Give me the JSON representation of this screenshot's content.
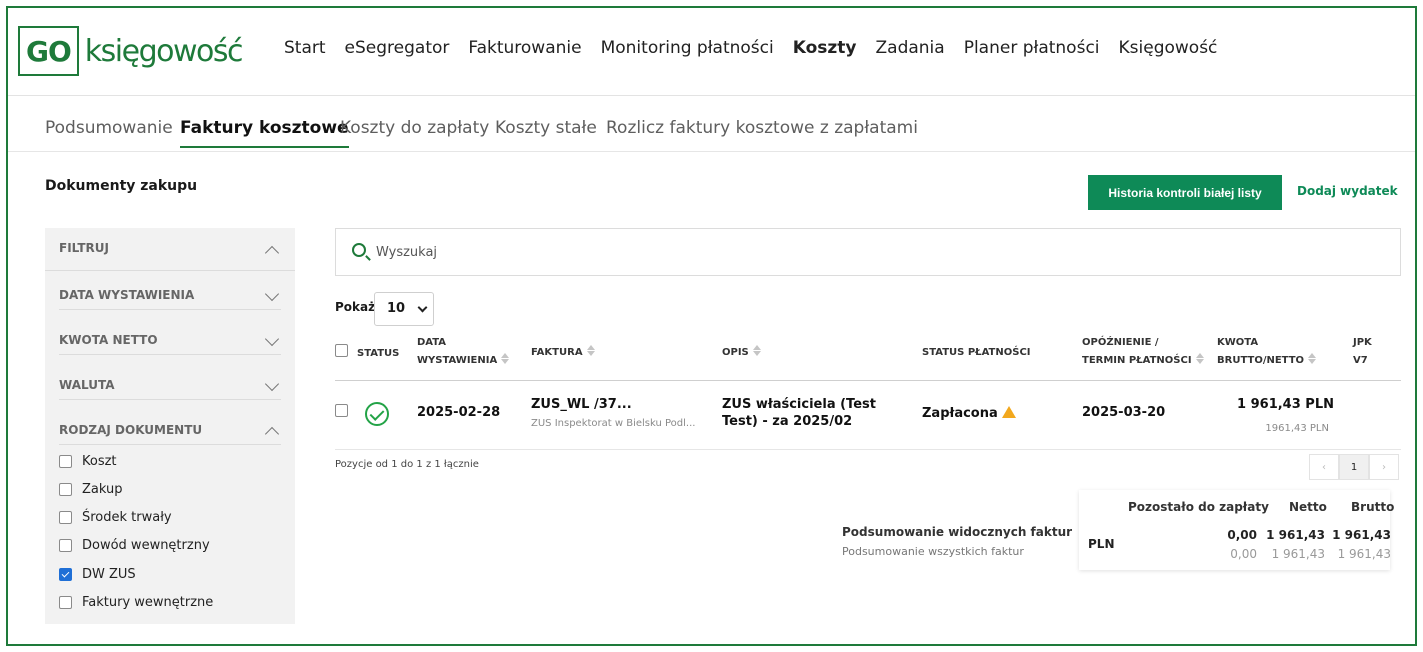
{
  "logo": {
    "badge": "GO",
    "text": "księgowość"
  },
  "main_nav": [
    {
      "label": "Start",
      "active": false
    },
    {
      "label": "eSegregator",
      "active": false
    },
    {
      "label": "Fakturowanie",
      "active": false
    },
    {
      "label": "Monitoring płatności",
      "active": false
    },
    {
      "label": "Koszty",
      "active": true
    },
    {
      "label": "Zadania",
      "active": false
    },
    {
      "label": "Planer płatności",
      "active": false
    },
    {
      "label": "Księgowość",
      "active": false
    }
  ],
  "sub_nav": {
    "summary": "Podsumowanie",
    "cost_invoices": "Faktury kosztowe",
    "costs_to_pay": "Koszty do zapłaty",
    "fixed_costs": "Koszty stałe",
    "settle": "Rozlicz faktury kosztowe z zapłatami"
  },
  "section_title": "Dokumenty zakupu",
  "buttons": {
    "history": "Historia kontroli białej listy",
    "add_expense": "Dodaj wydatek"
  },
  "filters": {
    "header": "FILTRUJ",
    "issue_date": "DATA WYSTAWIENIA",
    "net_amount": "KWOTA NETTO",
    "currency": "WALUTA",
    "doc_type": "RODZAJ DOKUMENTU",
    "doc_types": [
      {
        "label": "Koszt",
        "checked": false
      },
      {
        "label": "Zakup",
        "checked": false
      },
      {
        "label": "Środek trwały",
        "checked": false
      },
      {
        "label": "Dowód wewnętrzny",
        "checked": false
      },
      {
        "label": "DW ZUS",
        "checked": true
      },
      {
        "label": "Faktury wewnętrzne",
        "checked": false
      }
    ]
  },
  "search": {
    "placeholder": "Wyszukaj"
  },
  "show": {
    "label": "Pokaż",
    "value": "10"
  },
  "table": {
    "headers": {
      "status": "STATUS",
      "issue_date_1": "DATA",
      "issue_date_2": "WYSTAWIENIA",
      "invoice": "FAKTURA",
      "description": "OPIS",
      "payment_status": "STATUS PŁATNOŚCI",
      "delay_1": "OPÓŹNIENIE /",
      "delay_2": "TERMIN PŁATNOŚCI",
      "amount_1": "KWOTA",
      "amount_2": "BRUTTO/NETTO",
      "jpk_1": "JPK",
      "jpk_2": "V7"
    },
    "rows": [
      {
        "issue_date": "2025-02-28",
        "invoice": "ZUS_WL /37...",
        "issuer": "ZUS Inspektorat w Bielsku Podl...",
        "description_1": "ZUS właściciela (Test",
        "description_2": "Test) - za 2025/02",
        "payment_status": "Zapłacona",
        "due_date": "2025-03-20",
        "gross": "1 961,43  PLN",
        "net": "1961,43 PLN"
      }
    ]
  },
  "pagination": {
    "info": "Pozycje od 1 do 1 z 1 łącznie",
    "prev": "‹",
    "page": "1",
    "next": "›"
  },
  "summary": {
    "visible_label": "Podsumowanie widocznych faktur",
    "all_label": "Podsumowanie wszystkich faktur",
    "col_remaining": "Pozostało do zapłaty",
    "col_net": "Netto",
    "col_gross": "Brutto",
    "currency": "PLN",
    "visible": {
      "remaining": "0,00",
      "net": "1 961,43",
      "gross": "1 961,43"
    },
    "all": {
      "remaining": "0,00",
      "net": "1 961,43",
      "gross": "1 961,43"
    }
  },
  "colors": {
    "brand_green": "#1e7a3a",
    "button_green": "#0e8a57",
    "warning": "#f2a81d",
    "check_blue": "#1f6fd6"
  }
}
